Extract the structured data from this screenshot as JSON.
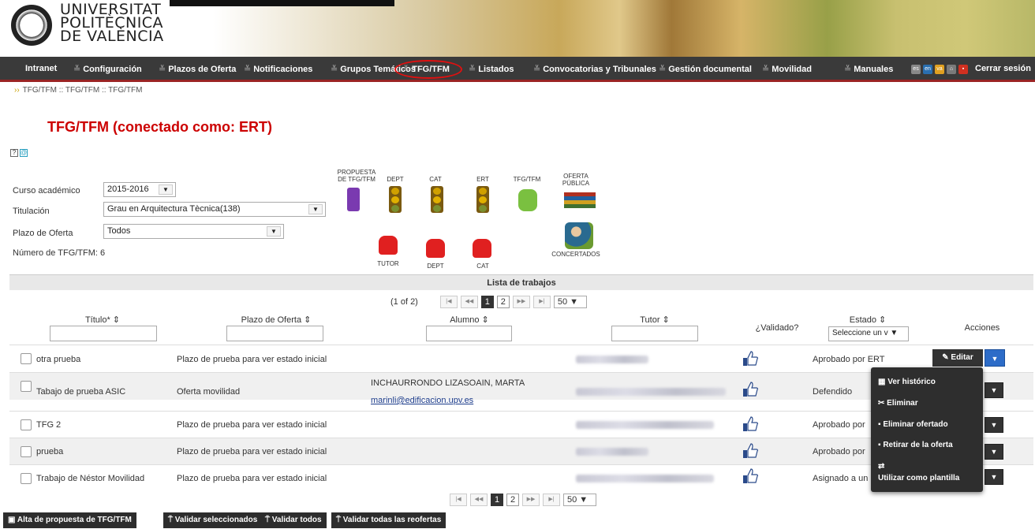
{
  "header": {
    "logo_line1": "UNIVERSITAT",
    "logo_line2": "POLITÈCNICA",
    "logo_line3": "DE VALÈNCIA"
  },
  "nav": {
    "intranet": "Intranet",
    "items": [
      "Configuración",
      "Plazos de Oferta",
      "Notificaciones",
      "Grupos Temáticos",
      "TFG/TFM",
      "Listados",
      "Convocatorias y Tribunales",
      "Gestión documental",
      "Movilidad",
      "Manuales"
    ],
    "logout": "Cerrar sesión",
    "active": "TFG/TFM",
    "highlight_color": "#e01010"
  },
  "breadcrumb": "TFG/TFM :: TFG/TFM :: TFG/TFM",
  "page_title": "TFG/TFM (conectado como: ERT)",
  "form": {
    "curso_label": "Curso académico",
    "curso_value": "2015-2016",
    "titulacion_label": "Titulación",
    "titulacion_value": "Grau en Arquitectura Tècnica(138)",
    "plazo_label": "Plazo de Oferta",
    "plazo_value": "Todos",
    "numero": "Número de TFG/TFM: 6"
  },
  "workflow": {
    "propuesta": "PROPUESTA DE TFG/TFM",
    "dept": "DEPT",
    "cat": "CAT",
    "ert": "ERT",
    "tfgtfm": "TFG/TFM",
    "oferta": "OFERTA PÚBLICA",
    "tutor": "TUTOR",
    "dept2": "DEPT",
    "cat2": "CAT",
    "concertados": "CONCERTADOS"
  },
  "table": {
    "title": "Lista de trabajos",
    "pager": {
      "info": "(1 of 2)",
      "first": "|◀",
      "prev": "◀◀",
      "pages": [
        "1",
        "2"
      ],
      "next": "▶▶",
      "last": "▶|",
      "per_page": "50"
    },
    "headers": {
      "titulo": "Título* ⇕",
      "plazo": "Plazo de Oferta ⇕",
      "alumno": "Alumno ⇕",
      "tutor": "Tutor ⇕",
      "validado": "¿Validado?",
      "estado": "Estado ⇕",
      "estado_select": "Seleccione un v",
      "acciones": "Acciones"
    },
    "rows": [
      {
        "titulo": "otra prueba",
        "plazo": "Plazo de prueba para ver estado inicial",
        "alumno": "",
        "email": "",
        "estado": "Aprobado por ERT"
      },
      {
        "titulo": "Tabajo de prueba ASIC",
        "plazo": "Oferta movilidad",
        "alumno": "INCHAURRONDO LIZASOAIN, MARTA",
        "email": "marinli@edificacion.upv.es",
        "estado": "Defendido"
      },
      {
        "titulo": "TFG 2",
        "plazo": "Plazo de prueba para ver estado inicial",
        "alumno": "",
        "email": "",
        "estado": "Aprobado por"
      },
      {
        "titulo": "prueba",
        "plazo": "Plazo de prueba para ver estado inicial",
        "alumno": "",
        "email": "",
        "estado": "Aprobado por"
      },
      {
        "titulo": "Trabajo de Néstor Movilidad",
        "plazo": "Plazo de prueba para ver estado inicial",
        "alumno": "",
        "email": "",
        "estado": "Asignado a un"
      }
    ],
    "editar": "Editar"
  },
  "menu": [
    "Ver histórico",
    "Eliminar",
    "Eliminar ofertado",
    "Retirar de la oferta",
    "Utilizar como plantilla"
  ],
  "bottom_buttons": [
    "Alta de propuesta de TFG/TFM",
    "Validar seleccionados",
    "Validar todos",
    "Validar todas las reofertas"
  ]
}
